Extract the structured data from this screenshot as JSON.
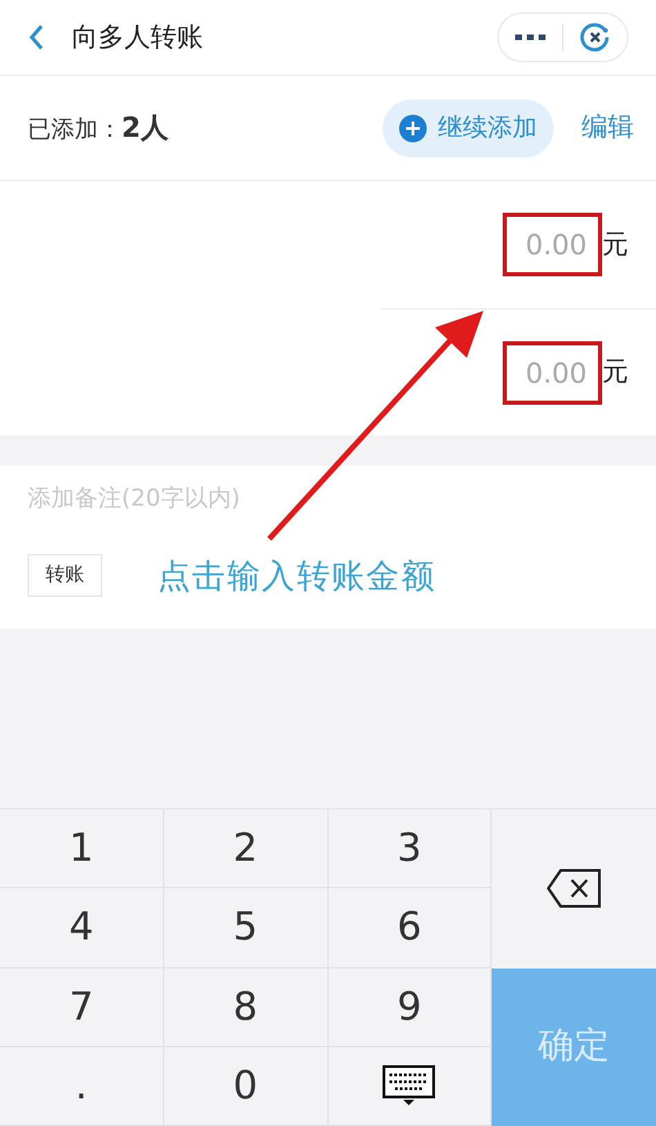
{
  "header": {
    "title": "向多人转账"
  },
  "summary": {
    "label": "已添加：",
    "count": "2人",
    "add_button": "继续添加",
    "edit_link": "编辑"
  },
  "recipients": [
    {
      "amount_placeholder": "0.00",
      "unit": "元",
      "highlighted": true
    },
    {
      "amount_placeholder": "0.00",
      "unit": "元",
      "highlighted": true
    }
  ],
  "remark": {
    "placeholder": "添加备注(20字以内)",
    "tag": "转账"
  },
  "annotation": {
    "text": "点击输入转账金额"
  },
  "keypad": {
    "rows": [
      [
        "1",
        "2",
        "3"
      ],
      [
        "4",
        "5",
        "6"
      ],
      [
        "7",
        "8",
        "9"
      ],
      [
        ".",
        "0"
      ]
    ],
    "confirm": "确定"
  }
}
